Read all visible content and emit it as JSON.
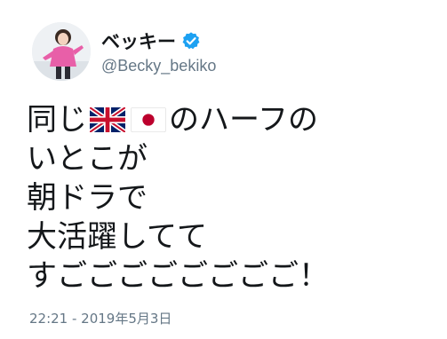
{
  "user": {
    "display_name": "ベッキー",
    "handle": "@Becky_bekiko",
    "verified": true,
    "avatar_icon": "avatar-photo"
  },
  "tweet": {
    "line1_prefix": "同じ",
    "flags": [
      "uk-flag-icon",
      "japan-flag-icon"
    ],
    "line1_suffix": "のハーフの",
    "line2": "いとこが",
    "line3": "朝ドラで",
    "line4": "大活躍してて",
    "line5": "すごごごごごごごご！"
  },
  "timestamp": "22:21 - 2019年5月3日",
  "colors": {
    "text": "#14171a",
    "muted": "#657786",
    "verified": "#1da1f2"
  }
}
